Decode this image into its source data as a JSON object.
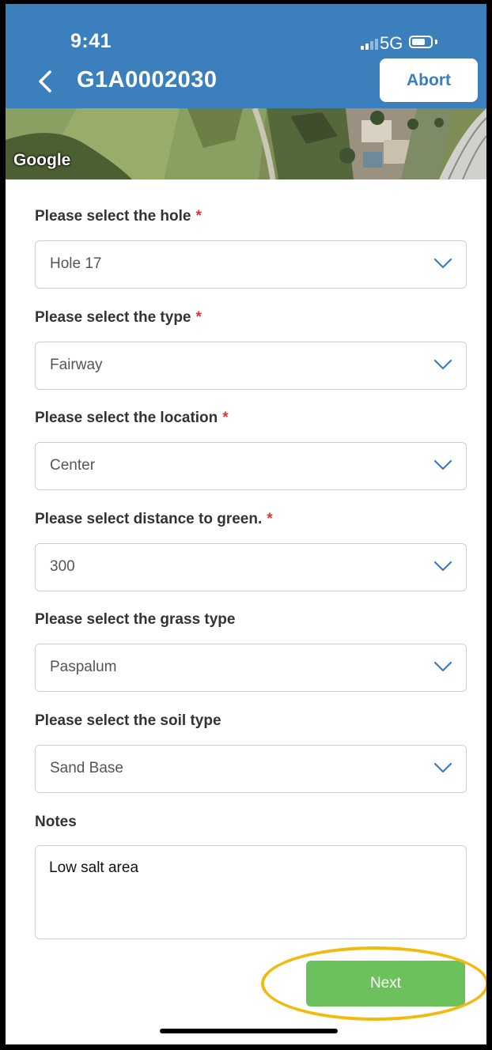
{
  "status_bar": {
    "time": "9:41",
    "network": "5G"
  },
  "header": {
    "title": "G1A0002030",
    "abort_label": "Abort",
    "background_color": "#3b80bd"
  },
  "map": {
    "attribution": "Google"
  },
  "form": {
    "fields": [
      {
        "label": "Please select the hole",
        "required": "*",
        "value": "Hole 17"
      },
      {
        "label": "Please select the type",
        "required": "*",
        "value": "Fairway"
      },
      {
        "label": "Please select the location",
        "required": "*",
        "value": "Center"
      },
      {
        "label": "Please select distance to green.",
        "required": "*",
        "value": "300"
      },
      {
        "label": "Please select the grass type",
        "value": "Paspalum"
      },
      {
        "label": "Please select the soil type",
        "value": "Sand Base"
      }
    ],
    "notes": {
      "label": "Notes",
      "value": "Low salt area"
    }
  },
  "footer": {
    "next_label": "Next",
    "next_color": "#6cc15d",
    "highlight_color": "#f2b90f"
  }
}
